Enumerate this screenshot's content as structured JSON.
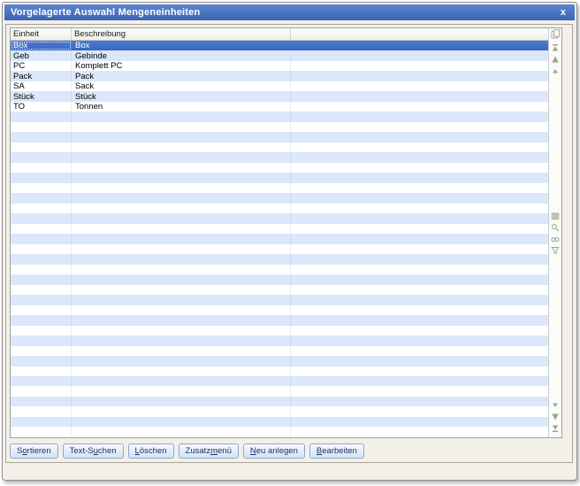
{
  "window": {
    "title": "Vorgelagerte Auswahl Mengeneinheiten",
    "close_label": "x"
  },
  "table": {
    "columns": [
      {
        "label": "Einheit"
      },
      {
        "label": "Beschreibung"
      },
      {
        "label": ""
      }
    ],
    "rows": [
      {
        "einheit": "Box",
        "beschreibung": "Box",
        "selected": true
      },
      {
        "einheit": "Geb",
        "beschreibung": "Gebinde"
      },
      {
        "einheit": "PC",
        "beschreibung": "Komplett PC"
      },
      {
        "einheit": "Pack",
        "beschreibung": "Pack"
      },
      {
        "einheit": "SA",
        "beschreibung": "Sack"
      },
      {
        "einheit": "Stück",
        "beschreibung": "Stück"
      },
      {
        "einheit": "TO",
        "beschreibung": "Tonnen"
      }
    ],
    "row_slots": 39
  },
  "side_rail": {
    "icons": [
      {
        "name": "copy",
        "glyph": "clipboard",
        "group": "header"
      },
      {
        "name": "scroll-first",
        "glyph": "first",
        "group": "top"
      },
      {
        "name": "scroll-up",
        "glyph": "up",
        "group": "top"
      },
      {
        "name": "scroll-up-small",
        "glyph": "upSmall",
        "group": "top"
      },
      {
        "name": "grid-columns",
        "glyph": "columns",
        "group": "mid"
      },
      {
        "name": "search",
        "glyph": "search",
        "group": "mid"
      },
      {
        "name": "binoculars",
        "glyph": "binoculars",
        "group": "mid"
      },
      {
        "name": "filter",
        "glyph": "filter",
        "group": "mid"
      },
      {
        "name": "scroll-down-small",
        "glyph": "downSmall",
        "group": "bot"
      },
      {
        "name": "scroll-down",
        "glyph": "down",
        "group": "bot"
      },
      {
        "name": "scroll-last",
        "glyph": "last",
        "group": "bot"
      }
    ]
  },
  "buttons": [
    {
      "label": "Sortieren",
      "mnemonic_index": 1
    },
    {
      "label": "Text-Suchen",
      "mnemonic_index": 6
    },
    {
      "label": "Löschen",
      "mnemonic_index": 0
    },
    {
      "label": "Zusatzmenü",
      "mnemonic_index": 6
    },
    {
      "label": "Neu anlegen",
      "mnemonic_index": 0
    },
    {
      "label": "Bearbeiten",
      "mnemonic_index": 0
    }
  ],
  "colors": {
    "title_top": "#5e86d2",
    "title_bottom": "#3a63b4",
    "selection_top": "#4d7bd0",
    "selection_bottom": "#3a68c0",
    "row_alt": "#dbe8f9",
    "button_face": "#d3e3f6",
    "button_border": "#8ea8cc",
    "rail_icon": "#9aa38f"
  }
}
